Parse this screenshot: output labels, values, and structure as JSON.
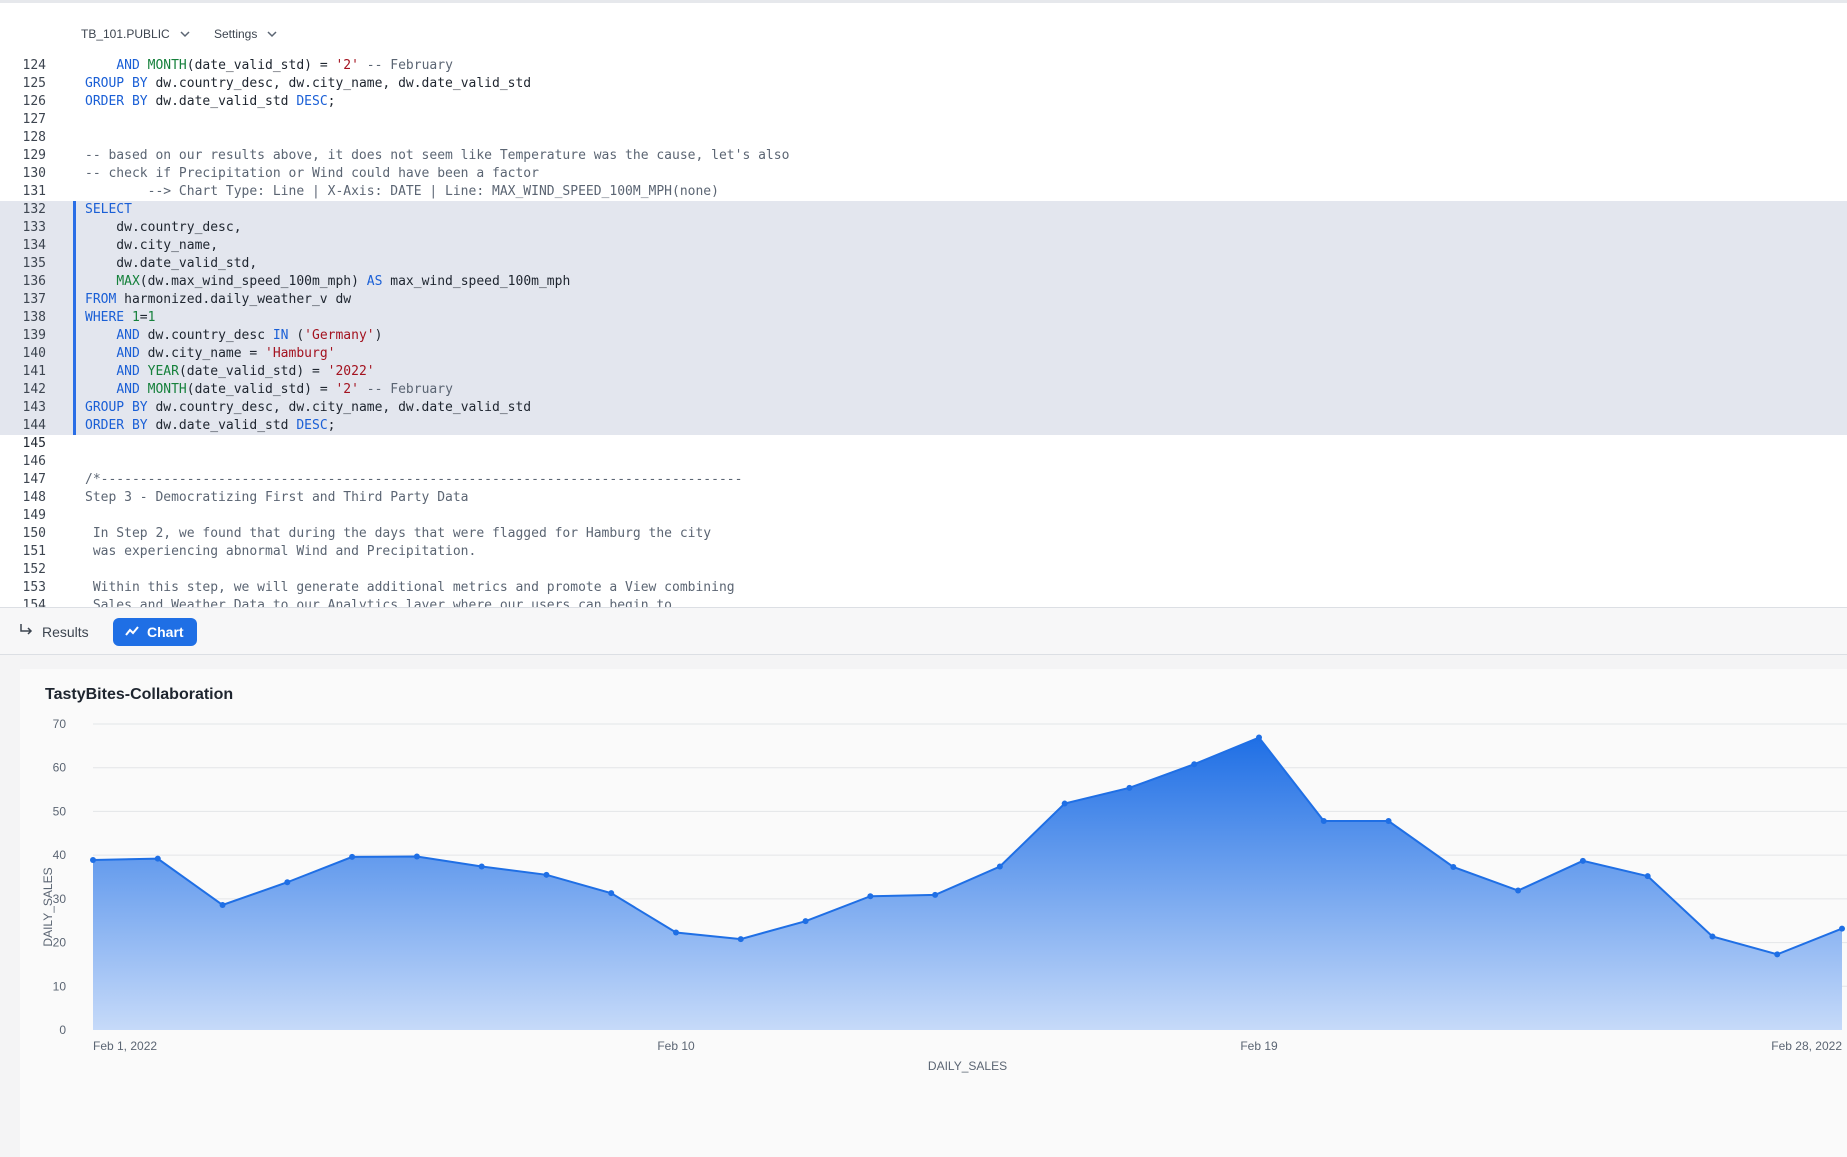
{
  "toolbar": {
    "database_label": "TB_101.PUBLIC",
    "settings_label": "Settings"
  },
  "editor": {
    "current_line": 145,
    "selection": {
      "start": 132,
      "end": 144
    },
    "lines": [
      {
        "n": 124,
        "tokens": [
          [
            "",
            "    "
          ],
          [
            "kw",
            "AND"
          ],
          [
            "",
            " "
          ],
          [
            "fn",
            "MONTH"
          ],
          [
            "",
            "(date_valid_std) = "
          ],
          [
            "str",
            "'2'"
          ],
          [
            "",
            " "
          ],
          [
            "cm",
            "-- February"
          ]
        ]
      },
      {
        "n": 125,
        "tokens": [
          [
            "kw",
            "GROUP BY"
          ],
          [
            "",
            " dw.country_desc, dw.city_name, dw.date_valid_std"
          ]
        ]
      },
      {
        "n": 126,
        "tokens": [
          [
            "kw",
            "ORDER BY"
          ],
          [
            "",
            " dw.date_valid_std "
          ],
          [
            "kw",
            "DESC"
          ],
          [
            "",
            ";"
          ]
        ]
      },
      {
        "n": 127,
        "tokens": []
      },
      {
        "n": 128,
        "tokens": []
      },
      {
        "n": 129,
        "tokens": [
          [
            "cm",
            "-- based on our results above, it does not seem like Temperature was the cause, let's also"
          ]
        ]
      },
      {
        "n": 130,
        "tokens": [
          [
            "cm",
            "-- check if Precipitation or Wind could have been a factor"
          ]
        ]
      },
      {
        "n": 131,
        "tokens": [
          [
            "cm",
            "        --> Chart Type: Line | X-Axis: DATE | Line: MAX_WIND_SPEED_100M_MPH(none)"
          ]
        ]
      },
      {
        "n": 132,
        "tokens": [
          [
            "kw",
            "SELECT"
          ]
        ]
      },
      {
        "n": 133,
        "tokens": [
          [
            "",
            "    dw.country_desc,"
          ]
        ]
      },
      {
        "n": 134,
        "tokens": [
          [
            "",
            "    dw.city_name,"
          ]
        ]
      },
      {
        "n": 135,
        "tokens": [
          [
            "",
            "    dw.date_valid_std,"
          ]
        ]
      },
      {
        "n": 136,
        "tokens": [
          [
            "",
            "    "
          ],
          [
            "fn",
            "MAX"
          ],
          [
            "",
            "(dw.max_wind_speed_100m_mph) "
          ],
          [
            "kw",
            "AS"
          ],
          [
            "",
            " max_wind_speed_100m_mph"
          ]
        ]
      },
      {
        "n": 137,
        "tokens": [
          [
            "kw",
            "FROM"
          ],
          [
            "",
            " harmonized.daily_weather_v dw"
          ]
        ]
      },
      {
        "n": 138,
        "tokens": [
          [
            "kw",
            "WHERE"
          ],
          [
            "",
            " "
          ],
          [
            "num",
            "1"
          ],
          [
            "",
            "="
          ],
          [
            "num",
            "1"
          ]
        ]
      },
      {
        "n": 139,
        "tokens": [
          [
            "",
            "    "
          ],
          [
            "kw",
            "AND"
          ],
          [
            "",
            " dw.country_desc "
          ],
          [
            "kw",
            "IN"
          ],
          [
            "",
            " ("
          ],
          [
            "str",
            "'Germany'"
          ],
          [
            "",
            ")"
          ]
        ]
      },
      {
        "n": 140,
        "tokens": [
          [
            "",
            "    "
          ],
          [
            "kw",
            "AND"
          ],
          [
            "",
            " dw.city_name = "
          ],
          [
            "str",
            "'Hamburg'"
          ]
        ]
      },
      {
        "n": 141,
        "tokens": [
          [
            "",
            "    "
          ],
          [
            "kw",
            "AND"
          ],
          [
            "",
            " "
          ],
          [
            "fn",
            "YEAR"
          ],
          [
            "",
            "(date_valid_std) = "
          ],
          [
            "str",
            "'2022'"
          ]
        ]
      },
      {
        "n": 142,
        "tokens": [
          [
            "",
            "    "
          ],
          [
            "kw",
            "AND"
          ],
          [
            "",
            " "
          ],
          [
            "fn",
            "MONTH"
          ],
          [
            "",
            "(date_valid_std) = "
          ],
          [
            "str",
            "'2'"
          ],
          [
            "",
            " "
          ],
          [
            "cm",
            "-- February"
          ]
        ]
      },
      {
        "n": 143,
        "tokens": [
          [
            "kw",
            "GROUP BY"
          ],
          [
            "",
            " dw.country_desc, dw.city_name, dw.date_valid_std"
          ]
        ]
      },
      {
        "n": 144,
        "tokens": [
          [
            "kw",
            "ORDER BY"
          ],
          [
            "",
            " dw.date_valid_std "
          ],
          [
            "kw",
            "DESC"
          ],
          [
            "",
            ";"
          ]
        ]
      },
      {
        "n": 145,
        "tokens": []
      },
      {
        "n": 146,
        "tokens": []
      },
      {
        "n": 147,
        "tokens": [
          [
            "cm",
            "/*----------------------------------------------------------------------------------"
          ]
        ]
      },
      {
        "n": 148,
        "tokens": [
          [
            "cm",
            "Step 3 - Democratizing First and Third Party Data"
          ]
        ]
      },
      {
        "n": 149,
        "tokens": []
      },
      {
        "n": 150,
        "tokens": [
          [
            "cm",
            " In Step 2, we found that during the days that were flagged for Hamburg the city"
          ]
        ]
      },
      {
        "n": 151,
        "tokens": [
          [
            "cm",
            " was experiencing abnormal Wind and Precipitation."
          ]
        ]
      },
      {
        "n": 152,
        "tokens": []
      },
      {
        "n": 153,
        "tokens": [
          [
            "cm",
            " Within this step, we will generate additional metrics and promote a View combining"
          ]
        ]
      },
      {
        "n": 154,
        "tokens": [
          [
            "cm",
            " Sales and Weather Data to our Analytics layer where our users can begin to"
          ]
        ]
      }
    ]
  },
  "tabs": {
    "results_label": "Results",
    "chart_label": "Chart",
    "active": "chart"
  },
  "chart_data": {
    "type": "area",
    "title": "TastyBites-Collaboration",
    "xlabel": "DAILY_SALES",
    "ylabel": "DAILY_SALES",
    "x": [
      "2022-02-01",
      "2022-02-02",
      "2022-02-03",
      "2022-02-04",
      "2022-02-05",
      "2022-02-06",
      "2022-02-07",
      "2022-02-08",
      "2022-02-09",
      "2022-02-10",
      "2022-02-11",
      "2022-02-12",
      "2022-02-13",
      "2022-02-14",
      "2022-02-15",
      "2022-02-16",
      "2022-02-17",
      "2022-02-18",
      "2022-02-19",
      "2022-02-20",
      "2022-02-21",
      "2022-02-22",
      "2022-02-23",
      "2022-02-24",
      "2022-02-25",
      "2022-02-26",
      "2022-02-27",
      "2022-02-28"
    ],
    "x_tick_labels": [
      {
        "at": "2022-02-01",
        "label": "Feb 1, 2022"
      },
      {
        "at": "2022-02-10",
        "label": "Feb 10"
      },
      {
        "at": "2022-02-19",
        "label": "Feb 19"
      },
      {
        "at": "2022-02-28",
        "label": "Feb 28, 2022"
      }
    ],
    "series": [
      {
        "values": [
          38.9,
          39.2,
          28.6,
          33.8,
          39.6,
          39.7,
          37.4,
          35.5,
          31.3,
          22.3,
          20.8,
          24.9,
          30.6,
          30.9,
          37.4,
          51.8,
          55.4,
          60.8,
          66.9,
          47.8,
          47.8,
          37.3,
          31.9,
          38.7,
          35.2,
          21.4,
          17.3,
          23.2
        ]
      }
    ],
    "ylim": [
      0,
      70
    ],
    "yticks": [
      0,
      10,
      20,
      30,
      40,
      50,
      60,
      70
    ],
    "grid": true,
    "colors": {
      "line": "#1f6fe5",
      "fill_top": "#1f6fe5",
      "fill_bottom": "#c6daf9",
      "grid": "#e3e5e8"
    }
  }
}
